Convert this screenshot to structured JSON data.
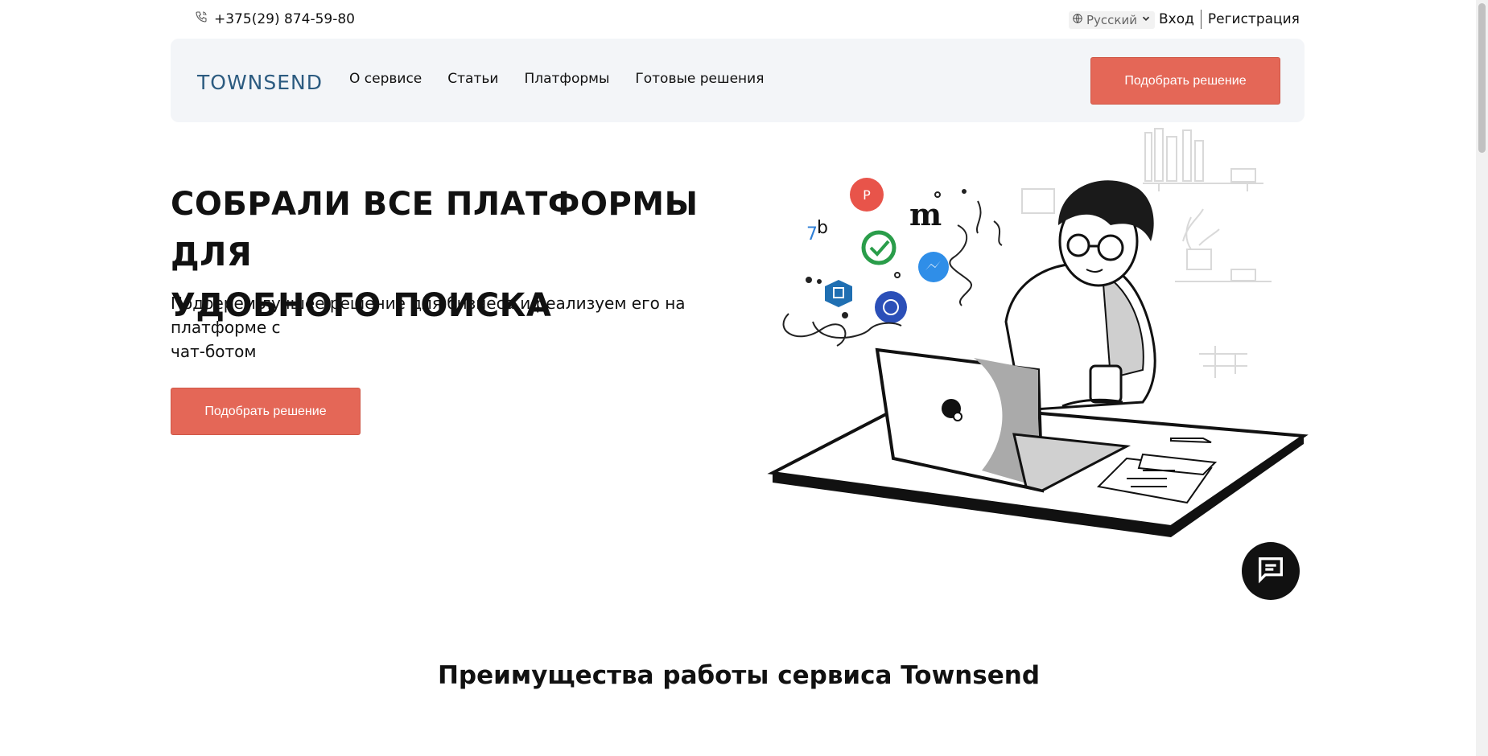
{
  "topbar": {
    "phone": "+375(29) 874-59-80",
    "phone_icon": "phone-icon",
    "language": "Русский",
    "language_icon": "globe-icon",
    "login": "Вход",
    "register": "Регистрация"
  },
  "header": {
    "logo": "TOWNSEND",
    "nav": [
      "О сервисе",
      "Статьи",
      "Платформы",
      "Готовые решения"
    ],
    "cta": "Подобрать решение"
  },
  "hero": {
    "title_line1": "СОБРАЛИ ВСЕ ПЛАТФОРМЫ ДЛЯ",
    "title_line2": "УДОБНОГО ПОИСКА",
    "subtitle_line1": "Подберем лучшее решение для бизнеса и реализуем его на платформе с",
    "subtitle_line2": "чат-ботом",
    "cta": "Подобрать решение"
  },
  "illustration": {
    "icons": [
      "puzzlebot-icon",
      "check-logo-icon",
      "messenger-icon",
      "bot-icon",
      "cube-icon",
      "m-letter-icon",
      "b-letter-icon"
    ],
    "accent_colors": {
      "red": "#e8544a",
      "blue": "#2f8ee8",
      "dark_blue": "#2b4fb8"
    }
  },
  "chat_widget": {
    "icon": "chat-icon"
  },
  "section": {
    "title": "Преимущества работы сервиса Townsend"
  },
  "colors": {
    "accent": "#e46757",
    "logo": "#2c5b80",
    "header_bg": "#f3f5f8"
  }
}
